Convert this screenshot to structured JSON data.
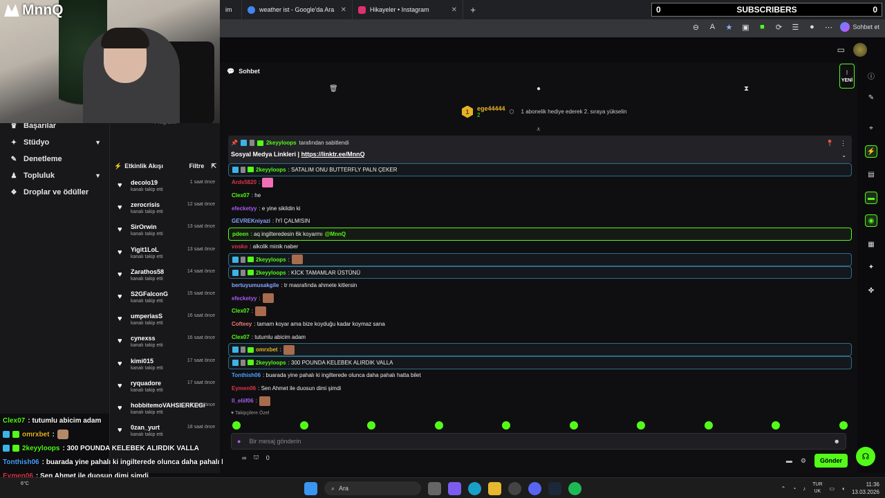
{
  "webcam": {
    "logo_text": "MnnQ"
  },
  "browser": {
    "tabs": [
      {
        "title": "im",
        "color": "#53fc18"
      },
      {
        "title": "weather ist - Google'da Ara",
        "color": "#4285f4"
      },
      {
        "title": "Hikayeler • Instagram",
        "color": "#e1306c"
      }
    ],
    "new_tab": "+",
    "profile_label": "Sohbet et"
  },
  "subs_overlay": {
    "left": "0",
    "label": "SUBSCRIBERS",
    "right": "0"
  },
  "left_nav": {
    "items": [
      {
        "label": "Başarılar",
        "icon": "trophy-icon",
        "chevron": false
      },
      {
        "label": "Stüdyo",
        "icon": "studio-icon",
        "chevron": true
      },
      {
        "label": "Denetleme",
        "icon": "wrench-icon",
        "chevron": false
      },
      {
        "label": "Topluluk",
        "icon": "community-icon",
        "chevron": true
      },
      {
        "label": "Droplar ve ödüller",
        "icon": "gift-icon",
        "chevron": false
      }
    ]
  },
  "activity_feed": {
    "program_label": "Programı",
    "title": "Etkinlik Akışı",
    "filter_label": "Filtre",
    "items": [
      {
        "name": "decolo19",
        "action": "kanalı takip etti",
        "time": "1 saat önce"
      },
      {
        "name": "zerocrisis",
        "action": "kanalı takip etti",
        "time": "12 saat önce"
      },
      {
        "name": "SirOrwin",
        "action": "kanalı takip etti",
        "time": "13 saat önce"
      },
      {
        "name": "Yigit1LoL",
        "action": "kanalı takip etti",
        "time": "13 saat önce"
      },
      {
        "name": "Zarathos58",
        "action": "kanalı takip etti",
        "time": "14 saat önce"
      },
      {
        "name": "S2GFalconG",
        "action": "kanalı takip etti",
        "time": "15 saat önce"
      },
      {
        "name": "umperiasS",
        "action": "kanalı takip etti",
        "time": "16 saat önce"
      },
      {
        "name": "cynexss",
        "action": "kanalı takip etti",
        "time": "16 saat önce"
      },
      {
        "name": "kimi015",
        "action": "kanalı takip etti",
        "time": "17 saat önce"
      },
      {
        "name": "ryquadore",
        "action": "kanalı takip etti",
        "time": "17 saat önce"
      },
      {
        "name": "hobbitemoVAHSIERKEGim",
        "action": "kanalı takip etti",
        "time": "17 saat önce"
      },
      {
        "name": "0zan_yurt",
        "action": "kanalı takip etti",
        "time": "18 saat önce"
      }
    ]
  },
  "overlay_chat": [
    {
      "user": "Clex07",
      "color": "#53fc18",
      "text": " : tutumlu abicim adam",
      "emote": false,
      "badges": false
    },
    {
      "user": "omrxbet",
      "color": "#e7b224",
      "text": " : ",
      "emote": true,
      "badges": true
    },
    {
      "user": "2keyyloops",
      "color": "#53fc18",
      "text": " : 300 POUNDA KELEBEK ALIRDIK VALLA",
      "emote": false,
      "badges": true
    },
    {
      "user": "Tonthish06",
      "color": "#4aa3ff",
      "text": " : buarada yine pahalı ki ingilterede olunca daha pahalı hatta bilet",
      "emote": false,
      "badges": false
    },
    {
      "user": "Eymen06",
      "color": "#e0354a",
      "text": " : Sen Ahmet ile duosun dimi şimdi",
      "emote": false,
      "badges": false
    },
    {
      "user": "ll_eliif06",
      "color": "#a85cf0",
      "text": " : ",
      "emote": true,
      "badges": false
    }
  ],
  "chat": {
    "title": "Sohbet",
    "new_label": "YENİ",
    "gifter": {
      "rank": "1",
      "name": "ege44444",
      "count": "2",
      "message": "1 abonelik hediye ederek 2. sıraya yükselin"
    },
    "pinned": {
      "pinned_by_user": "2keyyloops",
      "pinned_by_text": "tarafından sabitlendi",
      "label": "Sosyal Medya Linkleri |",
      "link": "https://linktr.ee/MnnQ"
    },
    "messages": [
      {
        "user": "2keyyloops",
        "color": "#53fc18",
        "text": ": SATALIM ONU BUTTERFLY PALN ÇEKER",
        "badges": true,
        "emote": false,
        "style": "hl"
      },
      {
        "user": "Ards5820",
        "color": "#e0354a",
        "text": ":",
        "badges": false,
        "emote": true,
        "emote_color": "pink",
        "style": ""
      },
      {
        "user": "Clex07",
        "color": "#53fc18",
        "text": ": he",
        "badges": false,
        "emote": false,
        "style": ""
      },
      {
        "user": "efecketyy",
        "color": "#a85cf0",
        "text": ": e yine sikildin ki",
        "badges": false,
        "emote": false,
        "style": ""
      },
      {
        "user": "GEVREKniyazi",
        "color": "#88a6ff",
        "text": ": İYİ ÇALMISIN",
        "badges": false,
        "emote": false,
        "style": ""
      },
      {
        "user": "pdeen",
        "color": "#53fc18",
        "text": ": aq ingilteredesin 6k koyarmı",
        "mention": "@MnnQ",
        "badges": false,
        "emote": false,
        "style": "me"
      },
      {
        "user": "vosko",
        "color": "#e0354a",
        "text": ": alkolik minik naber",
        "badges": false,
        "emote": false,
        "style": ""
      },
      {
        "user": "2keyyloops",
        "color": "#53fc18",
        "text": ":",
        "badges": true,
        "emote": true,
        "style": "hl"
      },
      {
        "user": "2keyyloops",
        "color": "#53fc18",
        "text": ": KİCK TAMAMLAR ÜSTÜNÜ",
        "badges": true,
        "emote": false,
        "style": "hl"
      },
      {
        "user": "bertuyumusakgile",
        "color": "#88a6ff",
        "text": ": tr masrafında ahmete kitlersin",
        "badges": false,
        "emote": false,
        "style": ""
      },
      {
        "user": "efecketyy",
        "color": "#a85cf0",
        "text": ":",
        "badges": false,
        "emote": true,
        "style": ""
      },
      {
        "user": "Clex07",
        "color": "#53fc18",
        "text": ":",
        "badges": false,
        "emote": true,
        "style": ""
      },
      {
        "user": "Cofteey",
        "color": "#f07a7a",
        "text": ": tamam koyar ama bize koyduğu kadar koymaz sana",
        "badges": false,
        "emote": false,
        "style": ""
      },
      {
        "user": "Clex07",
        "color": "#53fc18",
        "text": ": tutumlu abicim adam",
        "badges": false,
        "emote": false,
        "style": ""
      },
      {
        "user": "omrxbet",
        "color": "#e7b224",
        "text": ":",
        "badges": true,
        "emote": true,
        "style": "hl"
      },
      {
        "user": "2keyyloops",
        "color": "#53fc18",
        "text": ": 300 POUNDA KELEBEK ALIRDIK VALLA",
        "badges": true,
        "emote": false,
        "style": "hl"
      },
      {
        "user": "Tonthish06",
        "color": "#4aa3ff",
        "text": ": buarada yine pahalı ki ingilterede olunca daha pahalı hatta bilet",
        "badges": false,
        "emote": false,
        "style": ""
      },
      {
        "user": "Eymen06",
        "color": "#e0354a",
        "text": ": Sen Ahmet ile duosun dimi şimdi",
        "badges": false,
        "emote": false,
        "style": ""
      },
      {
        "user": "ll_eliif06",
        "color": "#a85cf0",
        "text": ":",
        "badges": false,
        "emote": true,
        "style": ""
      }
    ],
    "followers_label": "Takipçilere Özel",
    "input_placeholder": "Bir mesaj gönderin",
    "points": "0",
    "send_label": "Gönder"
  },
  "taskbar": {
    "weather": "6°C",
    "search_placeholder": "Ara",
    "lang_line1": "TUR",
    "lang_line2": "UK",
    "time": "11:36",
    "date": "13.03.2026"
  }
}
